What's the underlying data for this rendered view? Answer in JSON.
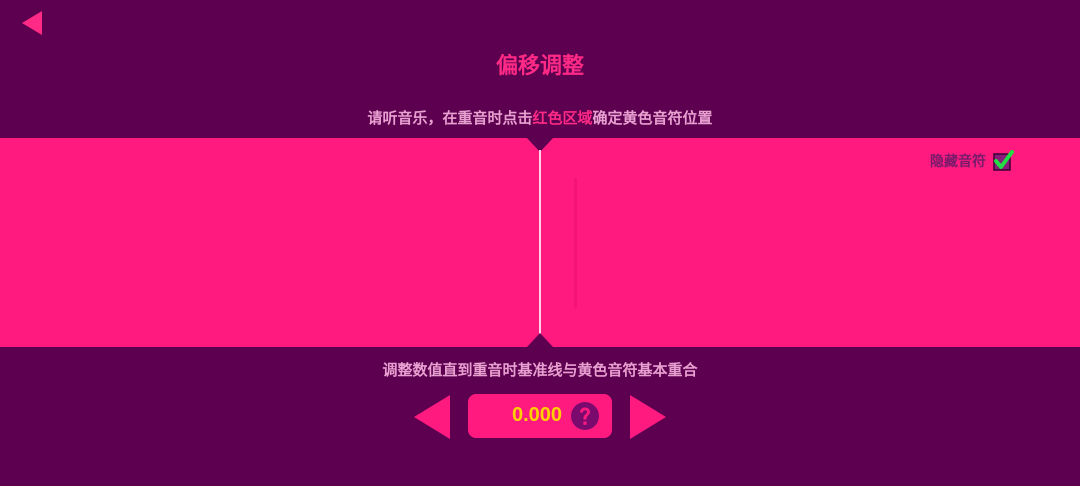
{
  "header": {
    "back_icon": "back-arrow-icon",
    "title": "偏移调整"
  },
  "instruction": {
    "part1": "请听音乐，在重音时点击",
    "highlight": "红色区域",
    "part2": "确定黄色音符位置"
  },
  "tap_area": {
    "color": "#ff1a80"
  },
  "hide_notes": {
    "label": "隐藏音符",
    "checked": true
  },
  "adjust": {
    "hint": "调整数值直到重音时基准线与黄色音符基本重合",
    "value": "0.000",
    "help_icon": "question-mark-icon"
  },
  "colors": {
    "background": "#5d0050",
    "accent": "#ff1a80",
    "value_text": "#ffd000",
    "check": "#22dd44"
  }
}
